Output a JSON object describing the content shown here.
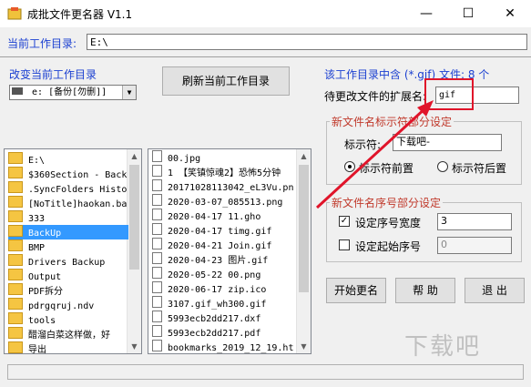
{
  "window": {
    "title": "成批文件更名器 V1.1"
  },
  "path_row": {
    "label": "当前工作目录:",
    "value": "E:\\"
  },
  "left": {
    "change_dir_label": "改变当前工作目录",
    "drive_value": "e: [备份[勿删]]",
    "tree_items": [
      {
        "label": "E:\\",
        "icon": "open-folder-icon"
      },
      {
        "label": "$360Section - Back",
        "icon": "folder-icon"
      },
      {
        "label": ".SyncFolders Histo",
        "icon": "folder-icon"
      },
      {
        "label": "[NoTitle]haokan.ba",
        "icon": "folder-icon"
      },
      {
        "label": "333",
        "icon": "folder-icon"
      },
      {
        "label": "BackUp",
        "icon": "folder-icon",
        "selected": true
      },
      {
        "label": "BMP",
        "icon": "folder-icon"
      },
      {
        "label": "Drivers Backup",
        "icon": "folder-icon"
      },
      {
        "label": "Output",
        "icon": "folder-icon"
      },
      {
        "label": "PDF拆分",
        "icon": "folder-icon"
      },
      {
        "label": "pdrgqruj.ndv",
        "icon": "folder-icon"
      },
      {
        "label": "tools",
        "icon": "folder-icon"
      },
      {
        "label": "醋溜白菜这样做，好",
        "icon": "folder-icon"
      },
      {
        "label": "导出",
        "icon": "folder-icon"
      }
    ]
  },
  "middle": {
    "refresh_label": "刷新当前工作目录",
    "files": [
      "00.jpg",
      "1 【笑镇惊魂2】恐怖5分钟",
      "20171028113042_eL3Vu.pn",
      "2020-03-07_085513.png",
      "2020-04-17 11.gho",
      "2020-04-17 timg.gif",
      "2020-04-21 Join.gif",
      "2020-04-23 图片.gif",
      "2020-05-22 00.png",
      "2020-06-17 zip.ico",
      "3107.gif_wh300.gif",
      "5993ecb2dd217.dxf",
      "5993ecb2dd217.pdf",
      "bookmarks_2019_12_19.ht"
    ]
  },
  "right": {
    "summary": "该工作目录中含 (*.gif) 文件: 8 个",
    "ext_label": "待更改文件的扩展名:",
    "ext_value": "gif",
    "name_group": {
      "title": "新文件名标示符部分设定",
      "marker_label": "标示符:",
      "marker_value": "下载吧-",
      "radio_front": "标示符前置",
      "radio_back": "标示符后置",
      "front_selected": true
    },
    "seq_group": {
      "title": "新文件名序号部分设定",
      "width_label": "设定序号宽度",
      "width_checked": true,
      "width_value": "3",
      "start_label": "设定起始序号",
      "start_checked": false,
      "start_value": "0"
    },
    "buttons": {
      "start": "开始更名",
      "help": "帮 助",
      "exit": "退 出"
    }
  },
  "watermark": "下载吧"
}
